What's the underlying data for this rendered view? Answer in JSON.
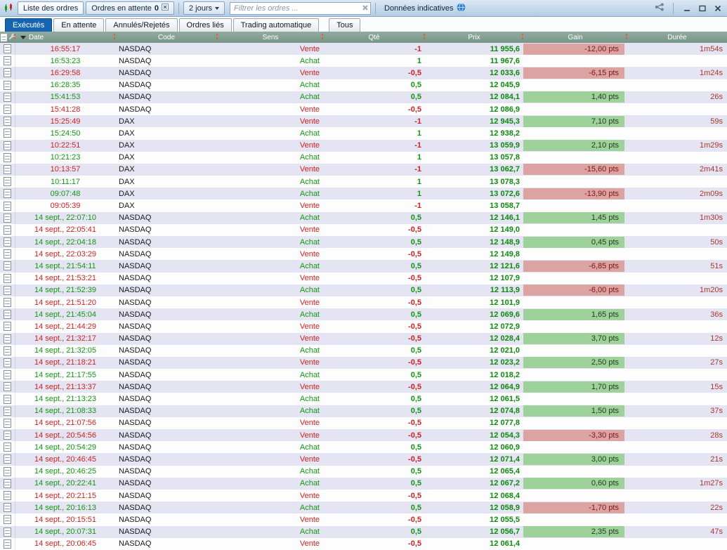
{
  "window": {
    "titlebar": {
      "list_orders_button": "Liste des ordres",
      "pending_orders_button": "Ordres en attente",
      "pending_count": "0",
      "period_selector": "2 jours",
      "filter_placeholder": "Filtrer les ordres ...",
      "indicative_data_label": "Données indicatives"
    },
    "tabs": [
      {
        "label": "Exécutés",
        "active": true
      },
      {
        "label": "En attente",
        "active": false
      },
      {
        "label": "Annulés/Rejetés",
        "active": false
      },
      {
        "label": "Ordres liés",
        "active": false
      },
      {
        "label": "Trading automatique",
        "active": false
      },
      {
        "label": "Tous",
        "active": false
      }
    ]
  },
  "table": {
    "headers": {
      "date": "Date",
      "code": "Code",
      "sens": "Sens",
      "qte": "Qté",
      "prix": "Prix",
      "gain": "Gain",
      "duree": "Durée"
    },
    "sort": {
      "column": "Date",
      "direction": "desc"
    },
    "side_labels": {
      "buy": "Achat",
      "sell": "Vente"
    },
    "rows": [
      {
        "date": "16:55:17",
        "code": "NASDAQ",
        "sens": "Vente",
        "qte": "-1",
        "prix": "11 955,6",
        "gain": "-12,00 pts",
        "duree": "1m54s"
      },
      {
        "date": "16:53:23",
        "code": "NASDAQ",
        "sens": "Achat",
        "qte": "1",
        "prix": "11 967,6",
        "gain": "",
        "duree": ""
      },
      {
        "date": "16:29:58",
        "code": "NASDAQ",
        "sens": "Vente",
        "qte": "-0,5",
        "prix": "12 033,6",
        "gain": "-6,15 pts",
        "duree": "1m24s"
      },
      {
        "date": "16:28:35",
        "code": "NASDAQ",
        "sens": "Achat",
        "qte": "0,5",
        "prix": "12 045,9",
        "gain": "",
        "duree": ""
      },
      {
        "date": "15:41:53",
        "code": "NASDAQ",
        "sens": "Achat",
        "qte": "0,5",
        "prix": "12 084,1",
        "gain": "1,40 pts",
        "duree": "26s"
      },
      {
        "date": "15:41:28",
        "code": "NASDAQ",
        "sens": "Vente",
        "qte": "-0,5",
        "prix": "12 086,9",
        "gain": "",
        "duree": ""
      },
      {
        "date": "15:25:49",
        "code": "DAX",
        "sens": "Vente",
        "qte": "-1",
        "prix": "12 945,3",
        "gain": "7,10 pts",
        "duree": "59s"
      },
      {
        "date": "15:24:50",
        "code": "DAX",
        "sens": "Achat",
        "qte": "1",
        "prix": "12 938,2",
        "gain": "",
        "duree": ""
      },
      {
        "date": "10:22:51",
        "code": "DAX",
        "sens": "Vente",
        "qte": "-1",
        "prix": "13 059,9",
        "gain": "2,10 pts",
        "duree": "1m29s"
      },
      {
        "date": "10:21:23",
        "code": "DAX",
        "sens": "Achat",
        "qte": "1",
        "prix": "13 057,8",
        "gain": "",
        "duree": ""
      },
      {
        "date": "10:13:57",
        "code": "DAX",
        "sens": "Vente",
        "qte": "-1",
        "prix": "13 062,7",
        "gain": "-15,60 pts",
        "duree": "2m41s"
      },
      {
        "date": "10:11:17",
        "code": "DAX",
        "sens": "Achat",
        "qte": "1",
        "prix": "13 078,3",
        "gain": "",
        "duree": ""
      },
      {
        "date": "09:07:48",
        "code": "DAX",
        "sens": "Achat",
        "qte": "1",
        "prix": "13 072,6",
        "gain": "-13,90 pts",
        "duree": "2m09s"
      },
      {
        "date": "09:05:39",
        "code": "DAX",
        "sens": "Vente",
        "qte": "-1",
        "prix": "13 058,7",
        "gain": "",
        "duree": ""
      },
      {
        "date": "14 sept., 22:07:10",
        "code": "NASDAQ",
        "sens": "Achat",
        "qte": "0,5",
        "prix": "12 146,1",
        "gain": "1,45 pts",
        "duree": "1m30s"
      },
      {
        "date": "14 sept., 22:05:41",
        "code": "NASDAQ",
        "sens": "Vente",
        "qte": "-0,5",
        "prix": "12 149,0",
        "gain": "",
        "duree": ""
      },
      {
        "date": "14 sept., 22:04:18",
        "code": "NASDAQ",
        "sens": "Achat",
        "qte": "0,5",
        "prix": "12 148,9",
        "gain": "0,45 pts",
        "duree": "50s"
      },
      {
        "date": "14 sept., 22:03:29",
        "code": "NASDAQ",
        "sens": "Vente",
        "qte": "-0,5",
        "prix": "12 149,8",
        "gain": "",
        "duree": ""
      },
      {
        "date": "14 sept., 21:54:11",
        "code": "NASDAQ",
        "sens": "Achat",
        "qte": "0,5",
        "prix": "12 121,6",
        "gain": "-6,85 pts",
        "duree": "51s"
      },
      {
        "date": "14 sept., 21:53:21",
        "code": "NASDAQ",
        "sens": "Vente",
        "qte": "-0,5",
        "prix": "12 107,9",
        "gain": "",
        "duree": ""
      },
      {
        "date": "14 sept., 21:52:39",
        "code": "NASDAQ",
        "sens": "Achat",
        "qte": "0,5",
        "prix": "12 113,9",
        "gain": "-6,00 pts",
        "duree": "1m20s"
      },
      {
        "date": "14 sept., 21:51:20",
        "code": "NASDAQ",
        "sens": "Vente",
        "qte": "-0,5",
        "prix": "12 101,9",
        "gain": "",
        "duree": ""
      },
      {
        "date": "14 sept., 21:45:04",
        "code": "NASDAQ",
        "sens": "Achat",
        "qte": "0,5",
        "prix": "12 069,6",
        "gain": "1,65 pts",
        "duree": "36s"
      },
      {
        "date": "14 sept., 21:44:29",
        "code": "NASDAQ",
        "sens": "Vente",
        "qte": "-0,5",
        "prix": "12 072,9",
        "gain": "",
        "duree": ""
      },
      {
        "date": "14 sept., 21:32:17",
        "code": "NASDAQ",
        "sens": "Vente",
        "qte": "-0,5",
        "prix": "12 028,4",
        "gain": "3,70 pts",
        "duree": "12s"
      },
      {
        "date": "14 sept., 21:32:05",
        "code": "NASDAQ",
        "sens": "Achat",
        "qte": "0,5",
        "prix": "12 021,0",
        "gain": "",
        "duree": ""
      },
      {
        "date": "14 sept., 21:18:21",
        "code": "NASDAQ",
        "sens": "Vente",
        "qte": "-0,5",
        "prix": "12 023,2",
        "gain": "2,50 pts",
        "duree": "27s"
      },
      {
        "date": "14 sept., 21:17:55",
        "code": "NASDAQ",
        "sens": "Achat",
        "qte": "0,5",
        "prix": "12 018,2",
        "gain": "",
        "duree": ""
      },
      {
        "date": "14 sept., 21:13:37",
        "code": "NASDAQ",
        "sens": "Vente",
        "qte": "-0,5",
        "prix": "12 064,9",
        "gain": "1,70 pts",
        "duree": "15s"
      },
      {
        "date": "14 sept., 21:13:23",
        "code": "NASDAQ",
        "sens": "Achat",
        "qte": "0,5",
        "prix": "12 061,5",
        "gain": "",
        "duree": ""
      },
      {
        "date": "14 sept., 21:08:33",
        "code": "NASDAQ",
        "sens": "Achat",
        "qte": "0,5",
        "prix": "12 074,8",
        "gain": "1,50 pts",
        "duree": "37s"
      },
      {
        "date": "14 sept., 21:07:56",
        "code": "NASDAQ",
        "sens": "Vente",
        "qte": "-0,5",
        "prix": "12 077,8",
        "gain": "",
        "duree": ""
      },
      {
        "date": "14 sept., 20:54:56",
        "code": "NASDAQ",
        "sens": "Vente",
        "qte": "-0,5",
        "prix": "12 054,3",
        "gain": "-3,30 pts",
        "duree": "28s"
      },
      {
        "date": "14 sept., 20:54:29",
        "code": "NASDAQ",
        "sens": "Achat",
        "qte": "0,5",
        "prix": "12 060,9",
        "gain": "",
        "duree": ""
      },
      {
        "date": "14 sept., 20:46:45",
        "code": "NASDAQ",
        "sens": "Vente",
        "qte": "-0,5",
        "prix": "12 071,4",
        "gain": "3,00 pts",
        "duree": "21s"
      },
      {
        "date": "14 sept., 20:46:25",
        "code": "NASDAQ",
        "sens": "Achat",
        "qte": "0,5",
        "prix": "12 065,4",
        "gain": "",
        "duree": ""
      },
      {
        "date": "14 sept., 20:22:41",
        "code": "NASDAQ",
        "sens": "Achat",
        "qte": "0,5",
        "prix": "12 067,2",
        "gain": "0,60 pts",
        "duree": "1m27s"
      },
      {
        "date": "14 sept., 20:21:15",
        "code": "NASDAQ",
        "sens": "Vente",
        "qte": "-0,5",
        "prix": "12 068,4",
        "gain": "",
        "duree": ""
      },
      {
        "date": "14 sept., 20:16:13",
        "code": "NASDAQ",
        "sens": "Achat",
        "qte": "0,5",
        "prix": "12 058,9",
        "gain": "-1,70 pts",
        "duree": "22s"
      },
      {
        "date": "14 sept., 20:15:51",
        "code": "NASDAQ",
        "sens": "Vente",
        "qte": "-0,5",
        "prix": "12 055,5",
        "gain": "",
        "duree": ""
      },
      {
        "date": "14 sept., 20:07:31",
        "code": "NASDAQ",
        "sens": "Achat",
        "qte": "0,5",
        "prix": "12 056,7",
        "gain": "2,35 pts",
        "duree": "47s"
      },
      {
        "date": "14 sept., 20:06:45",
        "code": "NASDAQ",
        "sens": "Vente",
        "qte": "-0,5",
        "prix": "12 061,4",
        "gain": "",
        "duree": ""
      }
    ]
  },
  "icons": {
    "app": "candlestick-chart",
    "popout": "close-box",
    "chevron_down": "▾",
    "clear_filter": "✕",
    "globe": "globe-bubble",
    "share": "share-nodes",
    "minimize": "—",
    "maximize": "❐",
    "close": "✕",
    "document": "order-note",
    "wrench": "column-settings",
    "sort_desc": "▼"
  },
  "colors": {
    "buy_green": "#129612",
    "sell_red": "#cc2222",
    "price_green": "#0d8a0d",
    "gain_positive_bg": "#9fd29b",
    "gain_negative_bg": "#dca3a3",
    "duration_red": "#a8392b",
    "active_tab_blue": "#1565b0",
    "table_header_green": "#7f9d90",
    "row_alternate_lavender": "#e4e4f2",
    "titlebar_top": "#dce9f4",
    "titlebar_bottom": "#b3cce3"
  }
}
